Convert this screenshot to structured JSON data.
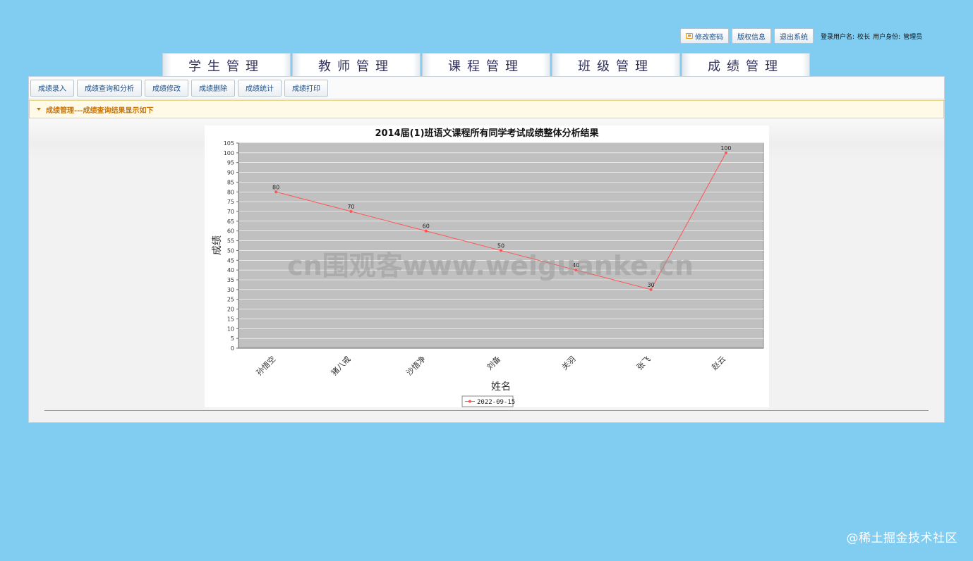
{
  "header": {
    "change_password": "修改密码",
    "copyright": "版权信息",
    "logout": "退出系统",
    "user_label": "登录用户名:",
    "user_name": "校长",
    "role_label": "用户身份:",
    "role_name": "管理员"
  },
  "main_tabs": [
    "学生管理",
    "教师管理",
    "课程管理",
    "班级管理",
    "成绩管理"
  ],
  "sub_toolbar": [
    "成绩录入",
    "成绩查询和分析",
    "成绩修改",
    "成绩删除",
    "成绩统计",
    "成绩打印"
  ],
  "section": {
    "title": "成绩管理---成绩查询结果显示如下"
  },
  "chart_data": {
    "type": "line",
    "title": "2014届(1)班语文课程所有同学考试成绩整体分析结果",
    "xlabel": "姓名",
    "ylabel": "成绩",
    "categories": [
      "孙悟空",
      "猪八戒",
      "沙悟净",
      "刘备",
      "关羽",
      "张飞",
      "赵云"
    ],
    "series": [
      {
        "name": "2022-09-15",
        "values": [
          80,
          70,
          60,
          50,
          40,
          30,
          100
        ],
        "color": "#ff5555"
      }
    ],
    "ylim": [
      0,
      105
    ],
    "ytick_step": 5,
    "grid": true,
    "legend": "bottom-center",
    "plot_bg": "#c0c0c0",
    "watermark": "cn围观客www.weiguanke.cn"
  },
  "watermark": "@稀土掘金技术社区"
}
